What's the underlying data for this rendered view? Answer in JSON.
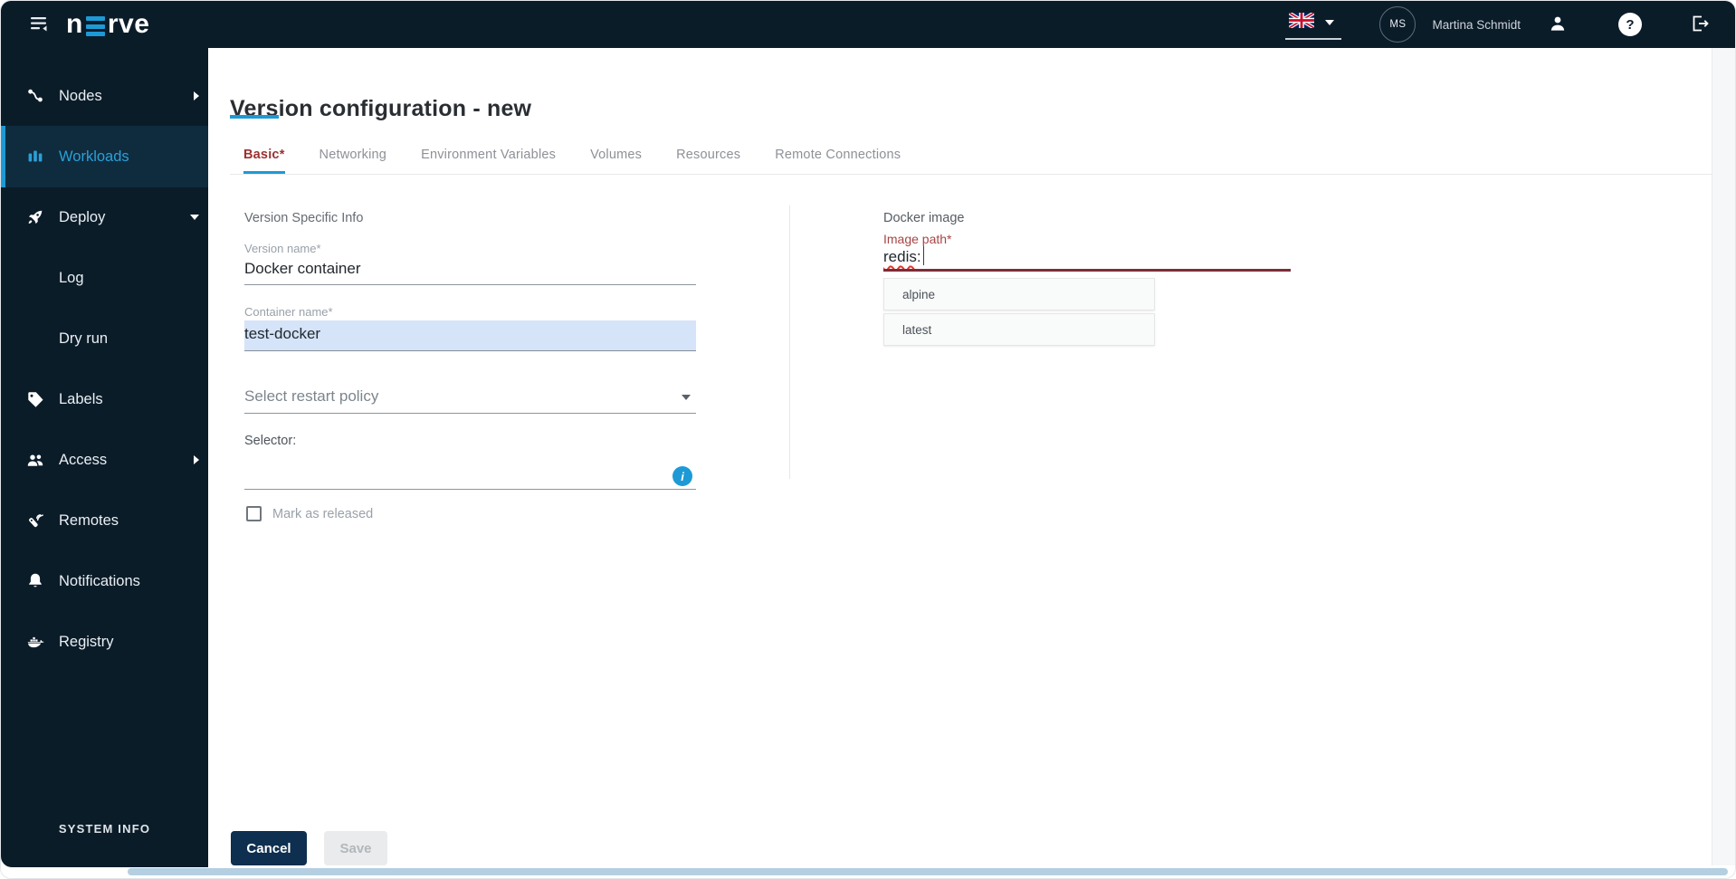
{
  "topbar": {
    "logo_prefix": "n",
    "logo_suffix": "rve",
    "logo_text": "nerve",
    "user_initials": "MS",
    "user_name": "Martina Schmidt"
  },
  "icons": {
    "help_glyph": "?",
    "info_glyph": "i"
  },
  "sidebar": {
    "items": [
      {
        "label": "Nodes",
        "icon": "nodes-icon",
        "expandable": true,
        "active": false
      },
      {
        "label": "Workloads",
        "icon": "workloads-icon",
        "active": true
      },
      {
        "label": "Deploy",
        "icon": "deploy-icon",
        "expanded": true
      },
      {
        "label": "Log",
        "sub_item": true
      },
      {
        "label": "Dry run",
        "sub_item": true
      },
      {
        "label": "Labels",
        "icon": "labels-icon"
      },
      {
        "label": "Access",
        "icon": "access-icon",
        "expandable": true
      },
      {
        "label": "Remotes",
        "icon": "remotes-icon"
      },
      {
        "label": "Notifications",
        "icon": "notifications-icon"
      },
      {
        "label": "Registry",
        "icon": "registry-icon"
      }
    ],
    "footer_label": "SYSTEM INFO"
  },
  "page": {
    "title": "Version configuration - new",
    "tabs": [
      {
        "label": "Basic*",
        "active": true,
        "has_error": true
      },
      {
        "label": "Networking",
        "active": false
      },
      {
        "label": "Environment Variables",
        "active": false
      },
      {
        "label": "Volumes",
        "active": false
      },
      {
        "label": "Resources",
        "active": false
      },
      {
        "label": "Remote Connections",
        "active": false
      }
    ]
  },
  "form": {
    "left": {
      "section_label": "Version Specific Info",
      "version_name_label": "Version name*",
      "version_name_value": "Docker container",
      "container_name_label": "Container name*",
      "container_name_value": "test-docker",
      "container_name_selected": true,
      "restart_policy_placeholder": "Select restart policy",
      "selector_label": "Selector:",
      "selector_value": "",
      "mark_released_label": "Mark as released",
      "mark_released_checked": false
    },
    "right": {
      "section_label": "Docker image",
      "image_path_label": "Image path*",
      "image_path_value_word": "redis",
      "image_path_value_suffix": ":",
      "image_path_error": true,
      "tag_suggestions": [
        "alpine",
        "latest"
      ]
    }
  },
  "actions": {
    "cancel_label": "Cancel",
    "save_label": "Save",
    "save_disabled": true
  },
  "colors": {
    "accent_blue": "#1d9ad6",
    "dark_navy": "#0b1c29",
    "tab_error_red": "#9c3131",
    "error_underline": "#7e2c38",
    "selection_blue": "#d5e4f8"
  }
}
